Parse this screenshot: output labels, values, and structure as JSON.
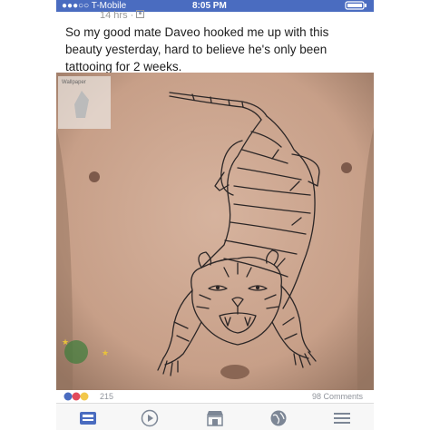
{
  "status_bar": {
    "carrier": "●●●○○ T-Mobile",
    "time": "8:05 PM",
    "battery": "▭"
  },
  "post": {
    "timestamp": "14 hrs · ",
    "text": "So my good mate Daveo hooked me up with this beauty yesterday, hard to believe he's only been tattooing for 2 weeks.",
    "image_alt": "tiger tattoo outline on chest",
    "reaction_count": "215",
    "comment_count": "98 Comments"
  },
  "tabbar": {
    "items": [
      {
        "name": "news-feed-icon"
      },
      {
        "name": "video-icon"
      },
      {
        "name": "marketplace-icon"
      },
      {
        "name": "globe-icon"
      },
      {
        "name": "menu-icon"
      }
    ]
  },
  "colors": {
    "status_bar": "#4a6cc0",
    "skin": "#caa58f",
    "tattoo_line": "#2b2626"
  }
}
